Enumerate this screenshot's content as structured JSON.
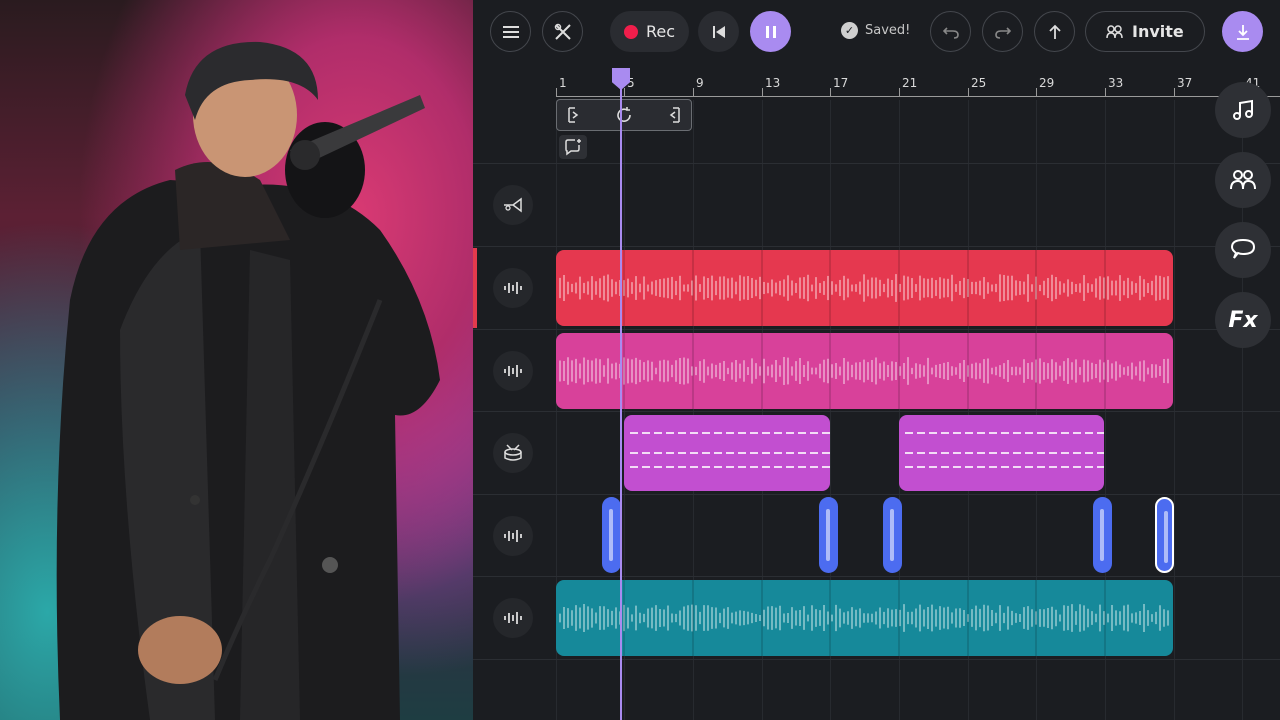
{
  "toolbar": {
    "rec_label": "Rec",
    "saved_label": "Saved!",
    "invite_label": "Invite"
  },
  "ruler": {
    "labels": [
      "1",
      "5",
      "9",
      "13",
      "17",
      "21",
      "25",
      "29",
      "33",
      "37",
      "41"
    ]
  },
  "tracks": [
    {
      "name": "instrument-track",
      "icon": "trumpet-icon"
    },
    {
      "name": "audio-track-1",
      "icon": "waveform-icon",
      "color": "#e5384f"
    },
    {
      "name": "audio-track-2",
      "icon": "waveform-icon",
      "color": "#d8419a"
    },
    {
      "name": "drum-track",
      "icon": "drum-icon",
      "color": "#c24fd0"
    },
    {
      "name": "audio-track-3",
      "icon": "waveform-icon",
      "color": "#4c6cf0"
    },
    {
      "name": "audio-track-4",
      "icon": "waveform-icon",
      "color": "#16899a"
    }
  ],
  "side_tools": [
    "music-note-icon",
    "collaborators-icon",
    "chat-icon",
    "Fx"
  ],
  "colors": {
    "accent": "#a98bf0",
    "record": "#f01e4b"
  }
}
